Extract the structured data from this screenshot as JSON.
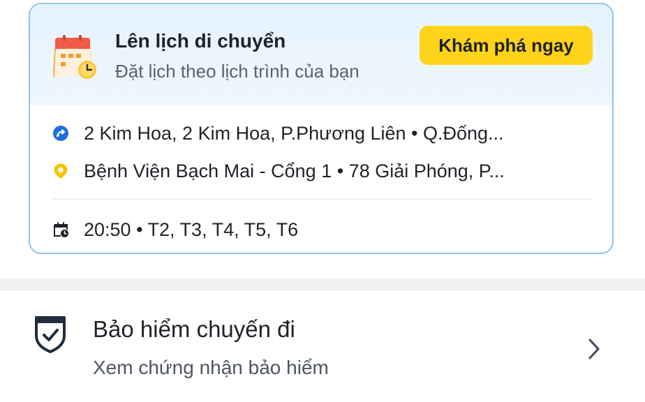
{
  "schedule": {
    "title": "Lên lịch di chuyển",
    "subtitle": "Đặt lịch theo lịch trình của bạn",
    "cta_label": "Khám phá ngay",
    "accent_color": "#ffd31a",
    "border_color": "#8fc3ee",
    "pickup": {
      "icon": "pickup-pin-icon",
      "text": "2 Kim Hoa, 2 Kim Hoa, P.Phương Liên • Q.Đống..."
    },
    "destination": {
      "icon": "destination-pin-icon",
      "text": "Bệnh Viện Bạch Mai - Cổng 1 • 78 Giải Phóng, P..."
    },
    "time": {
      "icon": "calendar-clock-icon",
      "text": "20:50 • T2, T3, T4, T5, T6"
    }
  },
  "insurance": {
    "icon": "shield-check-icon",
    "title": "Bảo hiểm chuyến đi",
    "subtitle": "Xem chứng nhận bảo hiểm",
    "action_icon": "chevron-right-icon"
  }
}
